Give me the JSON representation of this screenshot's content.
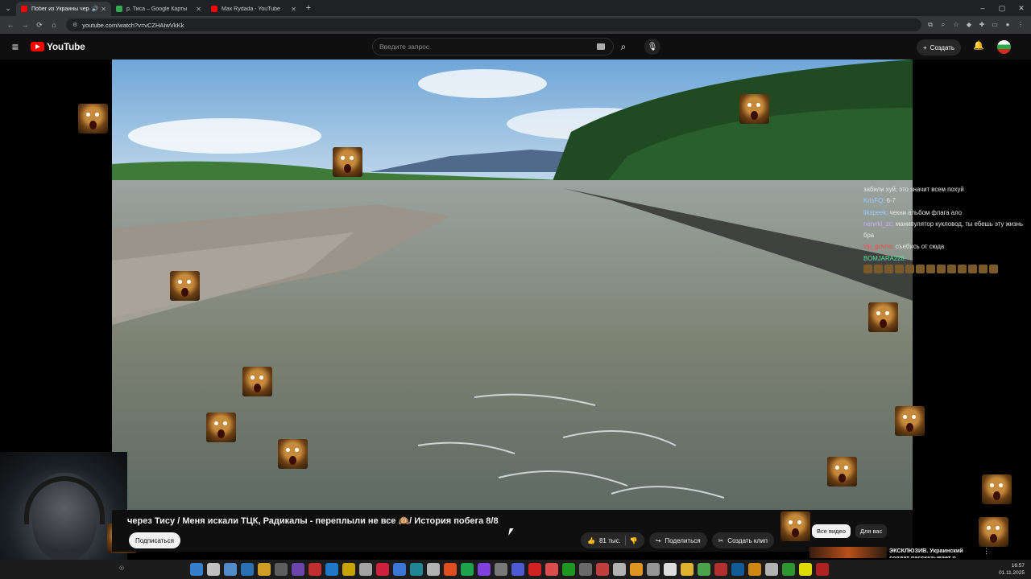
{
  "browser": {
    "tabs": [
      {
        "label": "Побег из Украины через Тису",
        "active": true,
        "favicon_color": "#ff0000"
      },
      {
        "label": "р. Тиса – Google Карты",
        "active": false,
        "favicon_color": "#34a853"
      },
      {
        "label": "Max Rydada - YouTube",
        "active": false,
        "favicon_color": "#ff0000"
      }
    ],
    "new_tab": "+",
    "url": "youtube.com/watch?v=vCZHAIwVkKk",
    "window_controls": [
      "–",
      "▢",
      "✕"
    ]
  },
  "youtube": {
    "logo_text": "YouTube",
    "search_placeholder": "Введите запрос",
    "create_label": "Создать"
  },
  "chat": {
    "messages": [
      {
        "user": "",
        "text": "забили хуй, это значит всем похуй",
        "user_color": ""
      },
      {
        "user": "KrisFQ:",
        "text": "6-7",
        "user_color": "#9ecbff"
      },
      {
        "user": "likspeek:",
        "text": "чекни альбом флага ало",
        "user_color": "#9ecbff"
      },
      {
        "user": "nervrkl_zc:",
        "text": "манипулятор кукловод, ты ебешь эту жизнь бра",
        "user_color": "#c9b0ff"
      },
      {
        "user": "vip_govno:",
        "text": "съебись от сюда",
        "user_color": "#ff4b4b"
      },
      {
        "user": "BOMJARA228:",
        "text": "",
        "user_color": "#5de2a2",
        "emote_count": 13
      }
    ]
  },
  "video": {
    "title": "через Тису / Меня искали ТЦК, Радикалы - переплыли не все 🙉/ История побега 8/8",
    "subscribe_label": "Подписаться",
    "like_count": "81 тыс.",
    "share_label": "Поделиться",
    "clip_label": "Создать клип"
  },
  "recommendations": {
    "chips": [
      "Все видео",
      "Для вас"
    ],
    "first_title": "ЭКСКЛЮЗИВ. Украинский солдат рассказывает о"
  },
  "taskbar": {
    "time": "16:57",
    "date": "01.11.2025"
  },
  "colors": {
    "youtube_red": "#ff0000",
    "page_bg": "#0f0f0f",
    "river": "#8a8a72",
    "sky": "#9fc3e0"
  }
}
